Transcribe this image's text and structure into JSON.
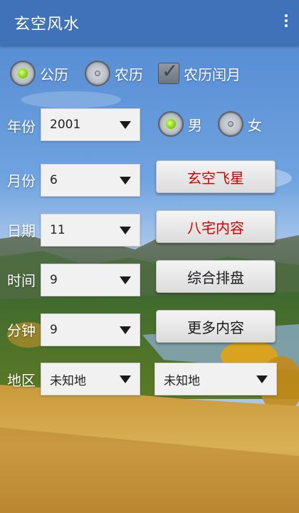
{
  "app": {
    "title": "玄空风水"
  },
  "calendar_options": {
    "solar": {
      "label": "公历",
      "selected": true
    },
    "lunar": {
      "label": "农历",
      "selected": false
    },
    "leap_month": {
      "label": "农历闰月",
      "checked": true
    }
  },
  "gender": {
    "male": {
      "label": "男",
      "selected": true
    },
    "female": {
      "label": "女",
      "selected": false
    }
  },
  "fields": {
    "year": {
      "label": "年份",
      "value": "2001"
    },
    "month": {
      "label": "月份",
      "value": "6"
    },
    "day": {
      "label": "日期",
      "value": "11"
    },
    "hour": {
      "label": "时间",
      "value": "9"
    },
    "minute": {
      "label": "分钟",
      "value": "9"
    },
    "region": {
      "label": "地区",
      "value": "未知地",
      "value2": "未知地"
    }
  },
  "buttons": {
    "xuankong": "玄空飞星",
    "bazhai": "八宅内容",
    "zonghe": "综合排盘",
    "more": "更多内容"
  },
  "colors": {
    "appbar": "#3f72b8",
    "accent_red": "#d40000",
    "radio_on": "#8fd21a"
  }
}
